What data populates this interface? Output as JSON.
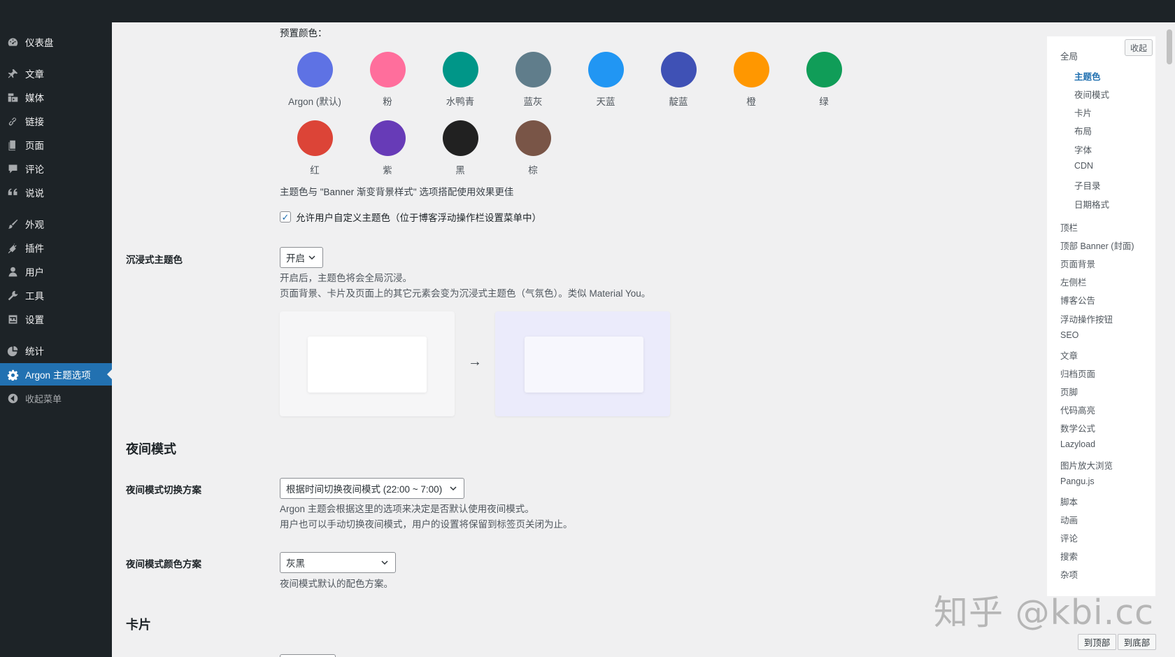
{
  "sidebar": {
    "items": [
      {
        "label": "仪表盘",
        "icon": "dashboard-icon"
      },
      {
        "label": "文章",
        "icon": "pin-icon"
      },
      {
        "label": "媒体",
        "icon": "media-icon"
      },
      {
        "label": "链接",
        "icon": "link-icon"
      },
      {
        "label": "页面",
        "icon": "page-icon"
      },
      {
        "label": "评论",
        "icon": "comment-icon"
      },
      {
        "label": "说说",
        "icon": "quote-icon"
      },
      {
        "label": "外观",
        "icon": "brush-icon"
      },
      {
        "label": "插件",
        "icon": "plugin-icon"
      },
      {
        "label": "用户",
        "icon": "user-icon"
      },
      {
        "label": "工具",
        "icon": "wrench-icon"
      },
      {
        "label": "设置",
        "icon": "settings-icon"
      },
      {
        "label": "统计",
        "icon": "pie-chart-icon"
      },
      {
        "label": "Argon 主题选项",
        "icon": "gear-icon"
      },
      {
        "label": "收起菜单",
        "icon": "collapse-arrow-icon"
      }
    ]
  },
  "theme_color": {
    "preset_label": "预置颜色：",
    "swatches": [
      {
        "name": "Argon (默认)",
        "color": "#5e72e4"
      },
      {
        "name": "粉",
        "color": "#ff6e9c"
      },
      {
        "name": "水鸭青",
        "color": "#009688"
      },
      {
        "name": "蓝灰",
        "color": "#607d8b"
      },
      {
        "name": "天蓝",
        "color": "#2196f3"
      },
      {
        "name": "靛蓝",
        "color": "#3f51b5"
      },
      {
        "name": "橙",
        "color": "#ff9700"
      },
      {
        "name": "绿",
        "color": "#109d58"
      },
      {
        "name": "红",
        "color": "#dc4437"
      },
      {
        "name": "紫",
        "color": "#673bb7"
      },
      {
        "name": "黑",
        "color": "#212121"
      },
      {
        "name": "棕",
        "color": "#795547"
      }
    ],
    "hint": "主题色与 \"Banner 渐变背景样式\" 选项搭配使用效果更佳",
    "allow_custom_label": "允许用户自定义主题色（位于博客浮动操作栏设置菜单中）",
    "allow_custom_checked": true
  },
  "immersive": {
    "label": "沉浸式主题色",
    "value": "开启",
    "desc1": "开启后，主题色将会全局沉浸。",
    "desc2": "页面背景、卡片及页面上的其它元素会变为沉浸式主题色（气氛色）。类似 Material You。",
    "arrow": "→"
  },
  "night_mode": {
    "heading": "夜间模式",
    "switch_label": "夜间模式切换方案",
    "switch_value": "根据时间切换夜间模式 (22:00 ~ 7:00)",
    "switch_desc1": "Argon 主题会根据这里的选项来决定是否默认使用夜间模式。",
    "switch_desc2": "用户也可以手动切换夜间模式，用户的设置将保留到标签页关闭为止。",
    "color_label": "夜间模式颜色方案",
    "color_value": "灰黑",
    "color_desc": "夜间模式默认的配色方案。"
  },
  "card_section": {
    "heading": "卡片"
  },
  "toc": {
    "collapse_label": "收起",
    "global": "全局",
    "sub_items": [
      "主题色",
      "夜间模式",
      "卡片",
      "布局",
      "字体",
      "CDN",
      "子目录",
      "日期格式"
    ],
    "items": [
      "顶栏",
      "顶部 Banner (封面)",
      "页面背景",
      "左侧栏",
      "博客公告",
      "浮动操作按钮",
      "SEO",
      "文章",
      "归档页面",
      "页脚",
      "代码高亮",
      "数学公式",
      "Lazyload",
      "图片放大浏览",
      "Pangu.js",
      "脚本",
      "动画",
      "评论",
      "搜索",
      "杂项"
    ]
  },
  "jump": {
    "top": "到顶部",
    "bottom": "到底部"
  },
  "watermark": "知乎 @kbi.cc"
}
